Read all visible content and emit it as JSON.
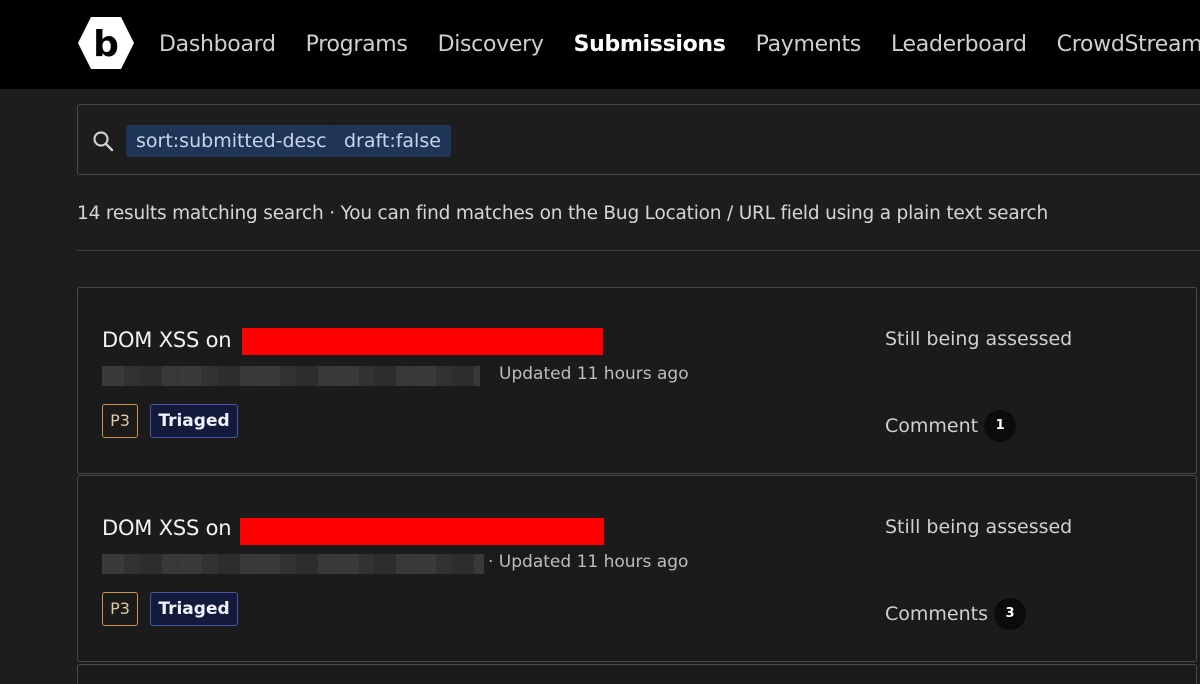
{
  "nav": {
    "items": [
      {
        "label": "Dashboard",
        "active": false
      },
      {
        "label": "Programs",
        "active": false
      },
      {
        "label": "Discovery",
        "active": false
      },
      {
        "label": "Submissions",
        "active": true
      },
      {
        "label": "Payments",
        "active": false
      },
      {
        "label": "Leaderboard",
        "active": false
      },
      {
        "label": "CrowdStream",
        "active": false
      }
    ]
  },
  "search": {
    "icon": "search-icon",
    "chips": [
      "sort:submitted-desc",
      "draft:false"
    ]
  },
  "results": {
    "summary": "14 results matching search · You can find matches on the Bug Location / URL field using a plain text search"
  },
  "submissions": [
    {
      "title": "DOM XSS on",
      "updated": "Updated 11 hours ago",
      "priority": "P3",
      "state": "Triaged",
      "status": "Still being assessed",
      "comment_label": "Comment",
      "comment_count": "1"
    },
    {
      "title": "DOM XSS on",
      "updated": "· Updated 11 hours ago",
      "priority": "P3",
      "state": "Triaged",
      "status": "Still being assessed",
      "comment_label": "Comments",
      "comment_count": "3"
    }
  ],
  "colors": {
    "accent_chip": "#1e3557",
    "priority_border": "#c7924c",
    "triaged_border": "#4a55a8",
    "redaction": "#ff0000"
  }
}
